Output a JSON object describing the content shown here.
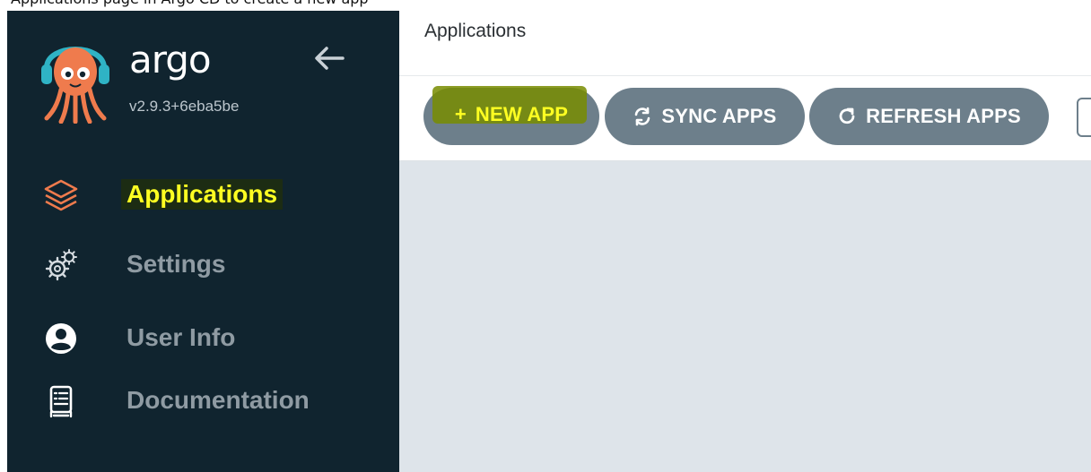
{
  "caption": "Applications page in Argo CD to create a new app",
  "app": {
    "name": "argo",
    "version": "v2.9.3+6eba5be"
  },
  "icons": {
    "logo": "argo-octopus-logo",
    "collapse": "arrow-left-icon",
    "applications": "layers-icon",
    "settings": "gears-icon",
    "user_info": "user-circle-icon",
    "documentation": "book-icon",
    "new_app": "plus-icon",
    "sync": "sync-icon",
    "refresh": "refresh-icon"
  },
  "sidebar": {
    "items": [
      {
        "label": "Applications",
        "active": true
      },
      {
        "label": "Settings",
        "active": false
      },
      {
        "label": "User Info",
        "active": false
      },
      {
        "label": "Documentation",
        "active": false
      }
    ]
  },
  "header": {
    "title": "Applications"
  },
  "toolbar": {
    "new_app_label": "NEW APP",
    "sync_apps_label": "SYNC APPS",
    "refresh_apps_label": "REFRESH APPS"
  },
  "colors": {
    "sidebar_bg": "#10242f",
    "button_bg": "#6d7f8b",
    "highlight": "#ffff22",
    "logo_orange": "#ef7b4d",
    "content_bg": "#dee4ea"
  }
}
